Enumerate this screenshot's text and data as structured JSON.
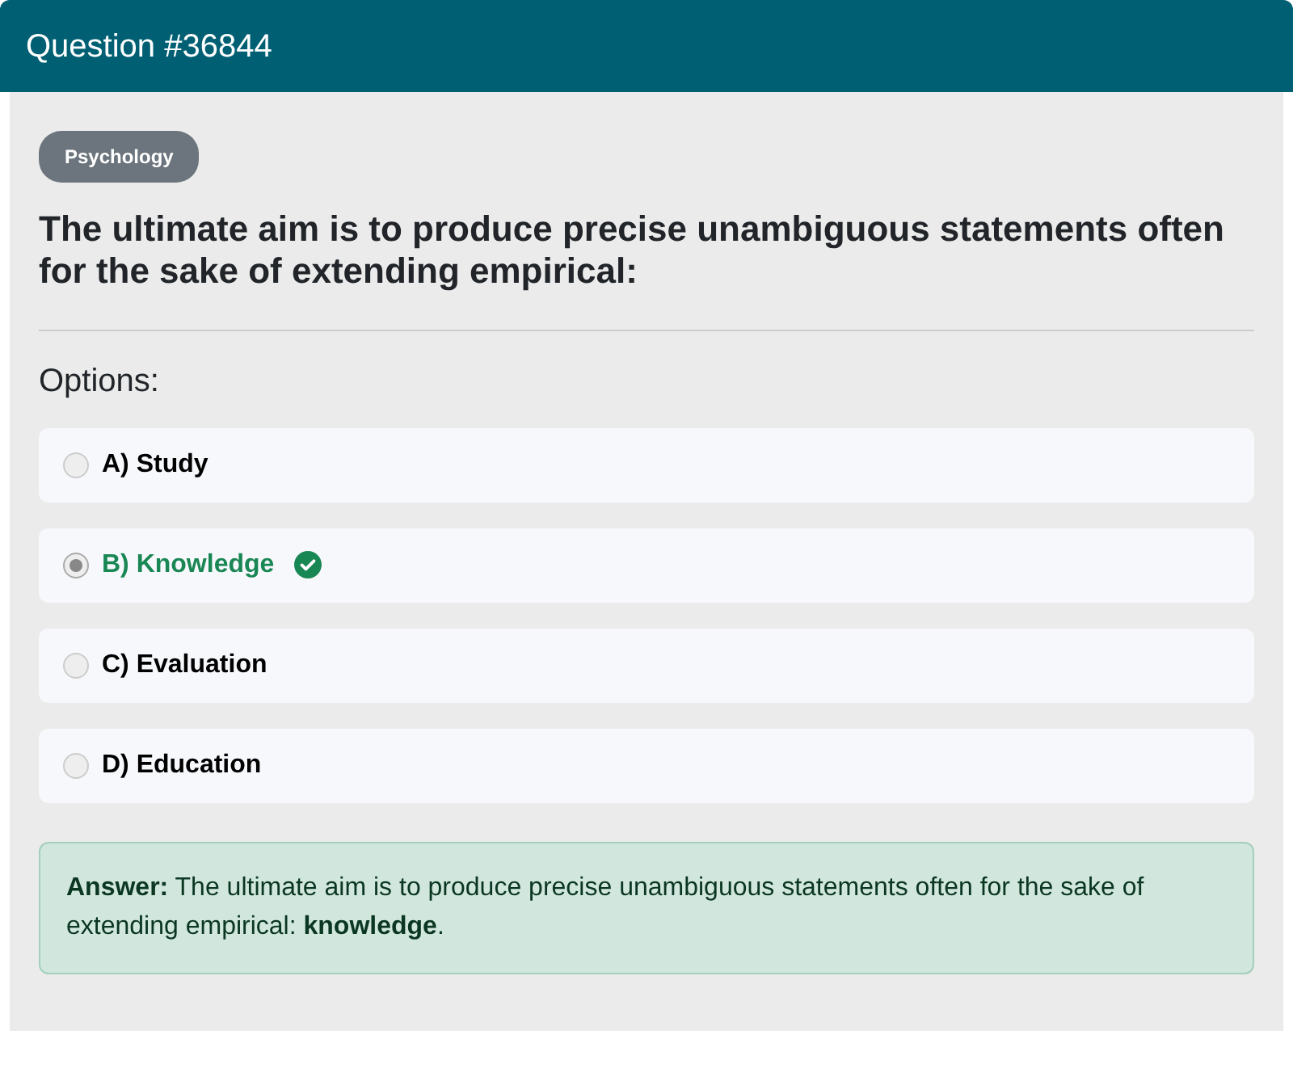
{
  "header": {
    "title": "Question #36844"
  },
  "category": "Psychology",
  "question": "The ultimate aim is to produce precise unambiguous statements often for the sake of extending empirical:",
  "options_label": "Options:",
  "options": [
    {
      "label": "A) Study",
      "selected": false,
      "correct": false
    },
    {
      "label": "B) Knowledge",
      "selected": true,
      "correct": true
    },
    {
      "label": "C) Evaluation",
      "selected": false,
      "correct": false
    },
    {
      "label": "D) Education",
      "selected": false,
      "correct": false
    }
  ],
  "answer": "**Answer:** The ultimate aim is to produce precise unambiguous statements often for the sake of extending empirical: **knowledge**."
}
